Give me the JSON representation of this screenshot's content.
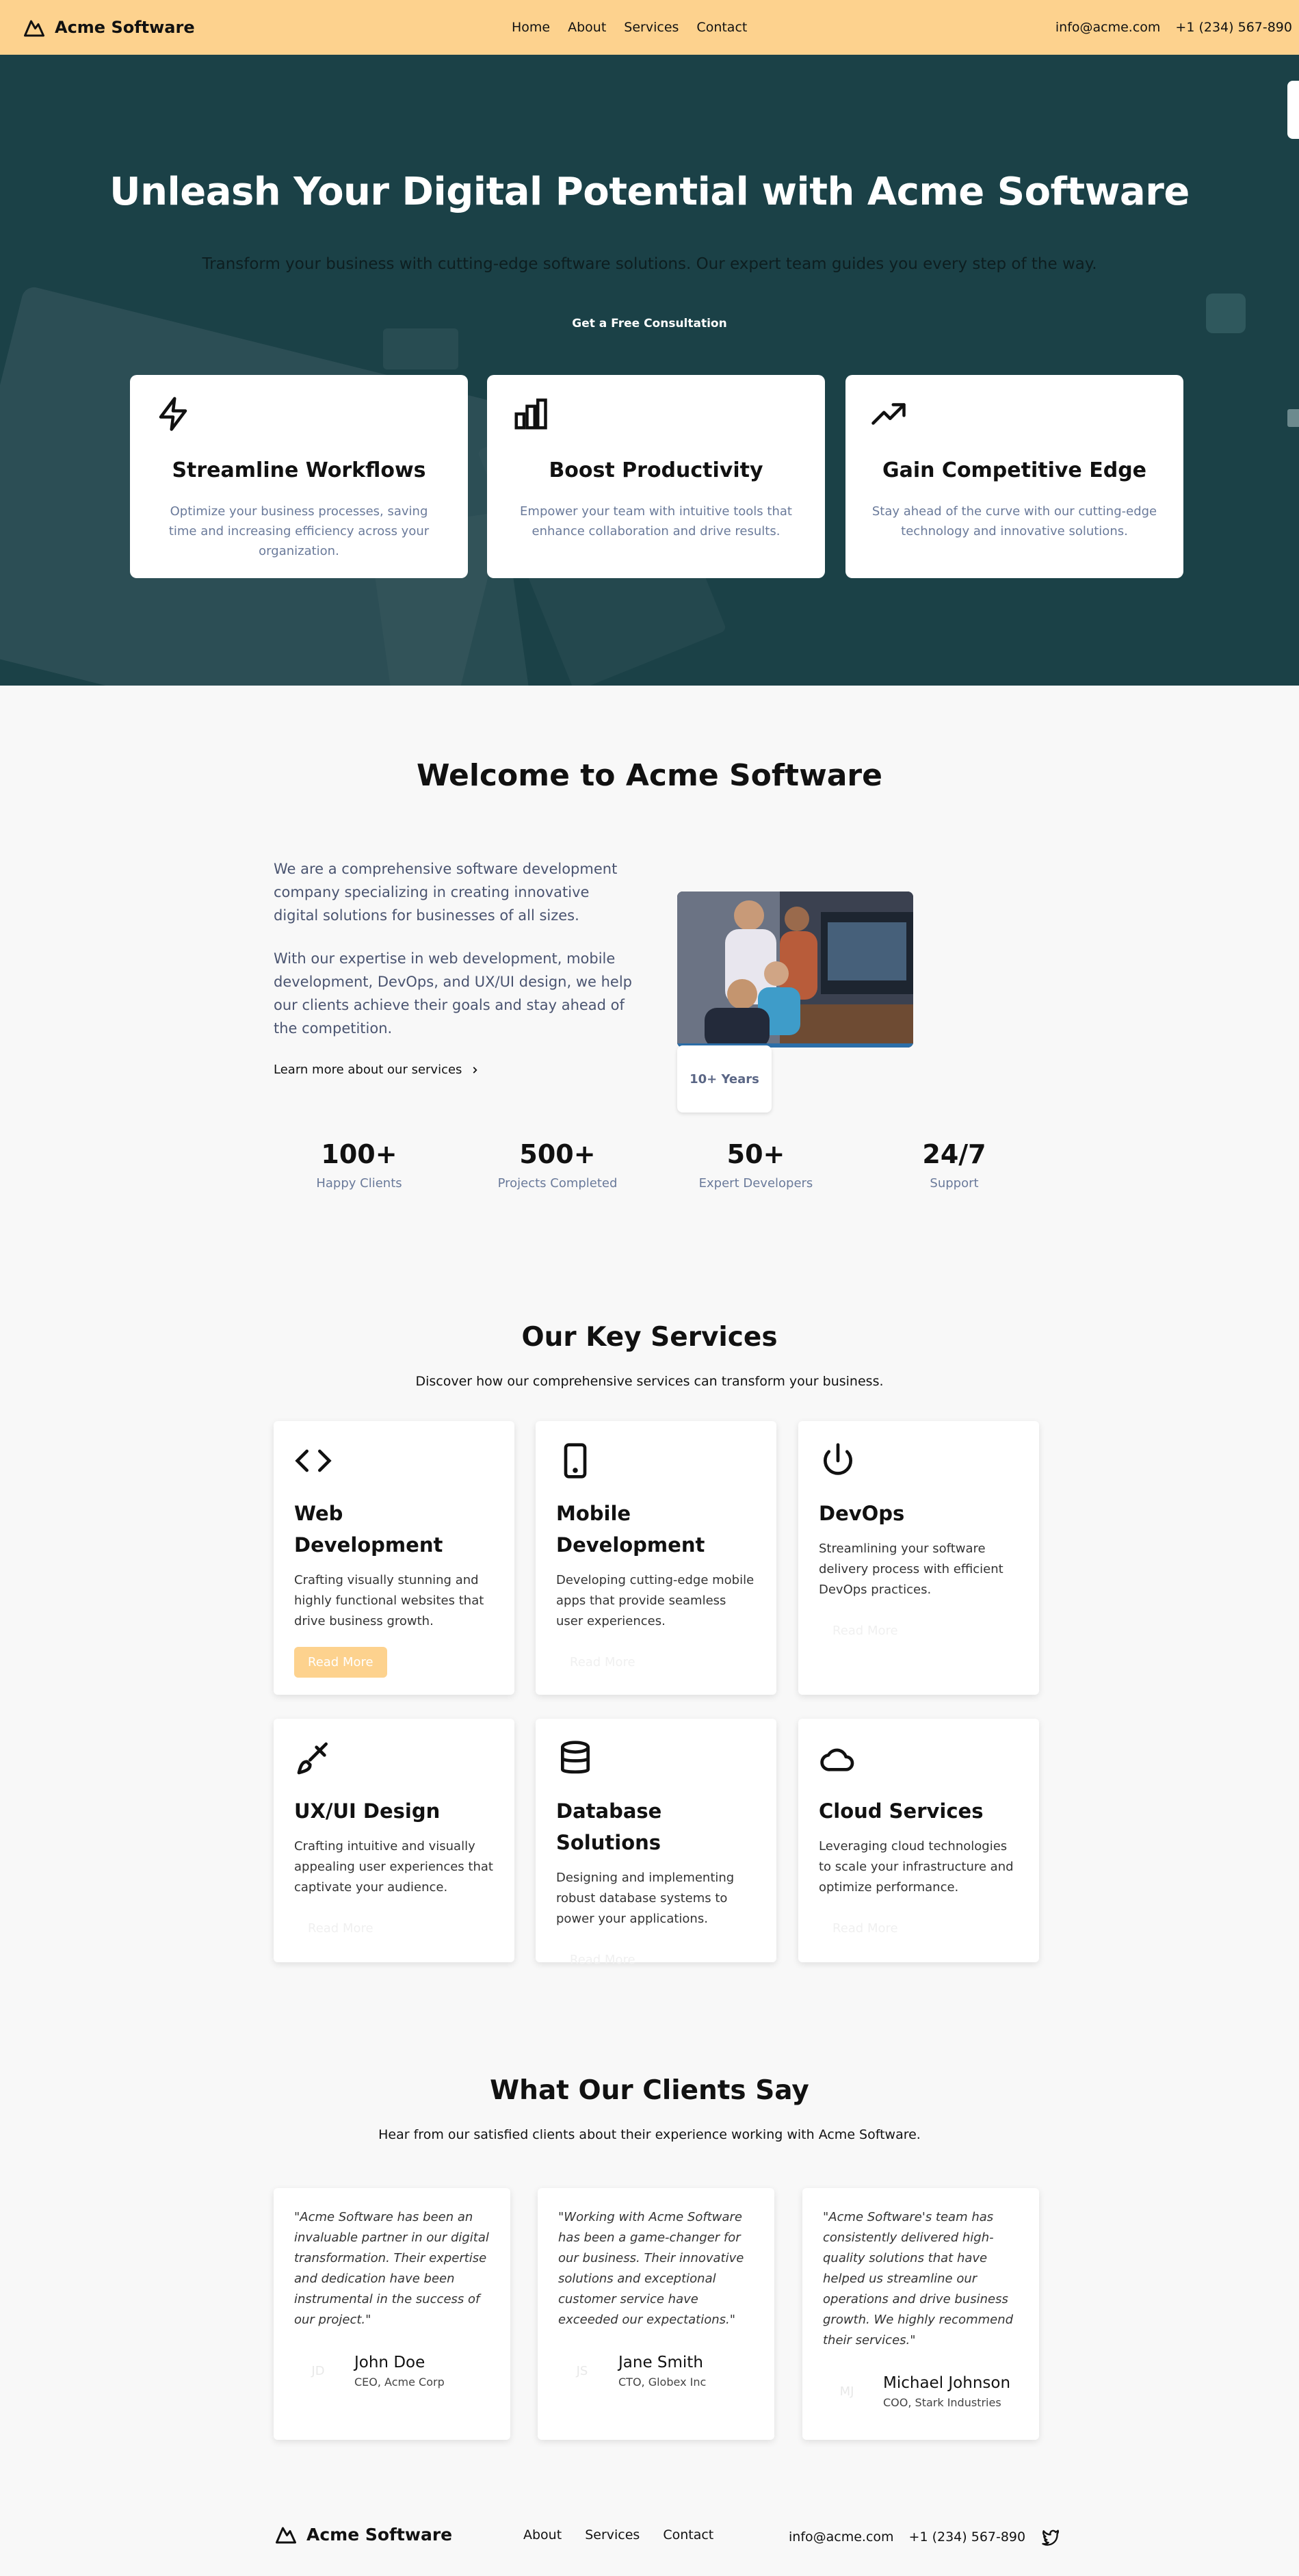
{
  "header": {
    "brand": "Acme Software",
    "nav": [
      "Home",
      "About",
      "Services",
      "Contact"
    ],
    "email": "info@acme.com",
    "phone": "+1 (234) 567-890"
  },
  "hero": {
    "title": "Unleash Your Digital Potential with Acme Software",
    "subtitle": "Transform your business with cutting-edge software solutions. Our expert team guides you every step of the way.",
    "cta": "Get a Free Consultation",
    "features": [
      {
        "icon": "lightning-icon",
        "title": "Streamline Workflows",
        "text": "Optimize your business processes, saving time and increasing efficiency across your organization."
      },
      {
        "icon": "bar-chart-icon",
        "title": "Boost Productivity",
        "text": "Empower your team with intuitive tools that enhance collaboration and drive results."
      },
      {
        "icon": "trending-up-icon",
        "title": "Gain Competitive Edge",
        "text": "Stay ahead of the curve with our cutting-edge technology and innovative solutions."
      }
    ]
  },
  "welcome": {
    "title": "Welcome to Acme Software",
    "p1": "We are a comprehensive software development company specializing in creating innovative digital solutions for businesses of all sizes.",
    "p2": "With our expertise in web development, mobile development, DevOps, and UX/UI design, we help our clients achieve their goals and stay ahead of the competition.",
    "learn_more": "Learn more about our services",
    "years_badge": "10+ Years",
    "stats": [
      {
        "value": "100+",
        "label": "Happy Clients"
      },
      {
        "value": "500+",
        "label": "Projects Completed"
      },
      {
        "value": "50+",
        "label": "Expert Developers"
      },
      {
        "value": "24/7",
        "label": "Support"
      }
    ]
  },
  "services": {
    "title": "Our Key Services",
    "subtitle": "Discover how our comprehensive services can transform your business.",
    "read_more": "Read More",
    "items": [
      {
        "icon": "code-icon",
        "title": "Web Development",
        "text": "Crafting visually stunning and highly functional websites that drive business growth."
      },
      {
        "icon": "smartphone-icon",
        "title": "Mobile Development",
        "text": "Developing cutting-edge mobile apps that provide seamless user experiences."
      },
      {
        "icon": "power-icon",
        "title": "DevOps",
        "text": "Streamlining your software delivery process with efficient DevOps practices."
      },
      {
        "icon": "brush-icon",
        "title": "UX/UI Design",
        "text": "Crafting intuitive and visually appealing user experiences that captivate your audience."
      },
      {
        "icon": "database-icon",
        "title": "Database Solutions",
        "text": "Designing and implementing robust database systems to power your applications."
      },
      {
        "icon": "cloud-icon",
        "title": "Cloud Services",
        "text": "Leveraging cloud technologies to scale your infrastructure and optimize performance."
      }
    ]
  },
  "testimonials": {
    "title": "What Our Clients Say",
    "subtitle": "Hear from our satisfied clients about their experience working with Acme Software.",
    "items": [
      {
        "quote": "\"Acme Software has been an invaluable partner in our digital transformation. Their expertise and dedication have been instrumental in the success of our project.\"",
        "initials": "JD",
        "name": "John Doe",
        "role": "CEO, Acme Corp"
      },
      {
        "quote": "\"Working with Acme Software has been a game-changer for our business. Their innovative solutions and exceptional customer service have exceeded our expectations.\"",
        "initials": "JS",
        "name": "Jane Smith",
        "role": "CTO, Globex Inc"
      },
      {
        "quote": "\"Acme Software's team has consistently delivered high-quality solutions that have helped us streamline our operations and drive business growth. We highly recommend their services.\"",
        "initials": "MJ",
        "name": "Michael Johnson",
        "role": "COO, Stark Industries"
      }
    ]
  },
  "footer": {
    "brand": "Acme Software",
    "nav": [
      "About",
      "Services",
      "Contact"
    ],
    "email": "info@acme.com",
    "phone": "+1 (234) 567-890"
  },
  "colors": {
    "header_bg": "#fdd28e",
    "hero_bg": "#1b4147",
    "accent": "#fdd28e"
  }
}
